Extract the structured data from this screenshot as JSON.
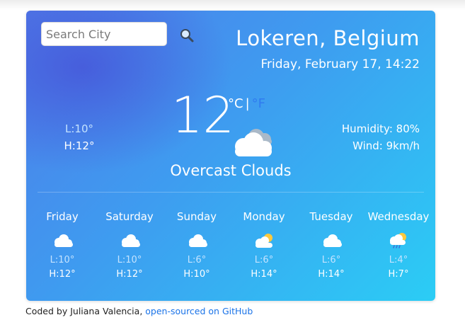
{
  "search": {
    "placeholder": "Search City"
  },
  "location": {
    "city": "Lokeren, Belgium",
    "datetime": "Friday, February 17, 14:22"
  },
  "current": {
    "temp": "12",
    "unit_c": "°C",
    "separator": "|",
    "unit_f": "°F",
    "description": "Overcast Clouds",
    "low": "L:10°",
    "high": "H:12°",
    "humidity": "Humidity: 80%",
    "wind": "Wind: 9km/h",
    "icon": "overcast-clouds-icon"
  },
  "forecast": [
    {
      "day": "Friday",
      "low": "L:10°",
      "high": "H:12°",
      "icon": "cloud-icon"
    },
    {
      "day": "Saturday",
      "low": "L:10°",
      "high": "H:12°",
      "icon": "cloud-icon"
    },
    {
      "day": "Sunday",
      "low": "L:6°",
      "high": "H:10°",
      "icon": "cloud-icon"
    },
    {
      "day": "Monday",
      "low": "L:6°",
      "high": "H:14°",
      "icon": "partly-sunny-icon"
    },
    {
      "day": "Tuesday",
      "low": "L:6°",
      "high": "H:14°",
      "icon": "cloud-icon"
    },
    {
      "day": "Wednesday",
      "low": "L:4°",
      "high": "H:7°",
      "icon": "rain-sun-icon"
    }
  ],
  "footer": {
    "text": "Coded by Juliana Valencia,",
    "link": "open-sourced on GitHub"
  },
  "colors": {
    "gradient_start": "#4f7ce8",
    "gradient_end": "#2bcdf5",
    "accent_link": "#1a73e8",
    "unit_f": "#2f7bf0"
  }
}
